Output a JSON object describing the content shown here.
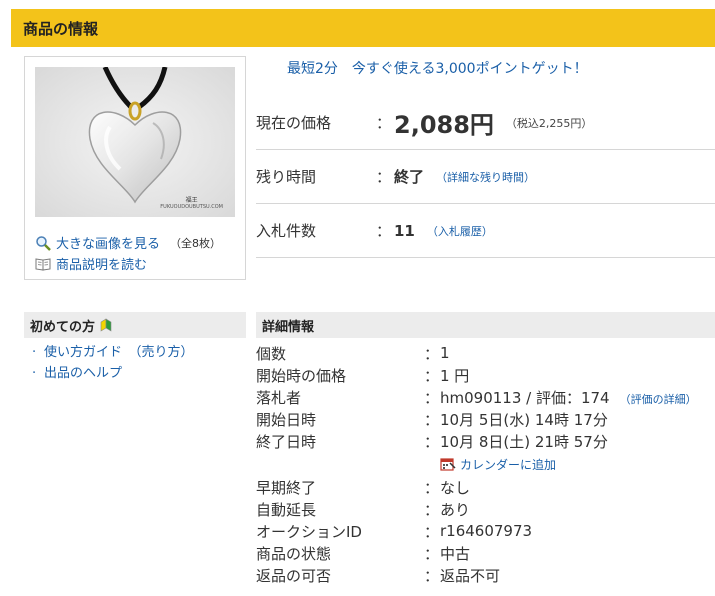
{
  "header": {
    "title": "商品の情報"
  },
  "image_panel": {
    "caption_line1": "福王",
    "caption_line2": "FUKUOUDOUBUTSU.COM",
    "large_image_link": "大きな画像を見る",
    "image_count": "（全8枚）",
    "description_link": "商品説明を読む"
  },
  "promo": {
    "part1": "最短2分",
    "part2": "今すぐ使える3,000ポイントゲット！"
  },
  "current_price": {
    "label": "現在の価格",
    "colon": "：",
    "value": "2,088円",
    "tax": "（税込2,255円）"
  },
  "time_left": {
    "label": "残り時間",
    "colon": "：",
    "value": "終了",
    "link": "（詳細な残り時間）"
  },
  "bids": {
    "label": "入札件数",
    "colon": "：",
    "value": "11",
    "link": "（入札履歴）"
  },
  "beginner": {
    "title": "初めての方",
    "items": [
      "使い方ガイド　（売り方）",
      "出品のヘルプ"
    ]
  },
  "detail": {
    "title": "詳細情報",
    "colon": "：",
    "rows": [
      {
        "key": "個数",
        "value": "1"
      },
      {
        "key": "開始時の価格",
        "value": "1 円"
      },
      {
        "key": "落札者",
        "value": "hm090113 / 評価：174",
        "sub": "（評価の詳細）"
      },
      {
        "key": "開始日時",
        "value": "10月 5日(水) 14時 17分"
      },
      {
        "key": "終了日時",
        "value": "10月 8日(土) 21時 57分"
      }
    ],
    "calendar_link": "カレンダーに追加",
    "rows2": [
      {
        "key": "早期終了",
        "value": "なし"
      },
      {
        "key": "自動延長",
        "value": "あり"
      },
      {
        "key": "オークションID",
        "value": "r164607973"
      },
      {
        "key": "商品の状態",
        "value": "中古"
      },
      {
        "key": "返品の可否",
        "value": "返品不可"
      }
    ]
  },
  "colors": {
    "header_bg": "#f3c31a",
    "link": "#1a5fa8",
    "panel_gray": "#ececec"
  }
}
